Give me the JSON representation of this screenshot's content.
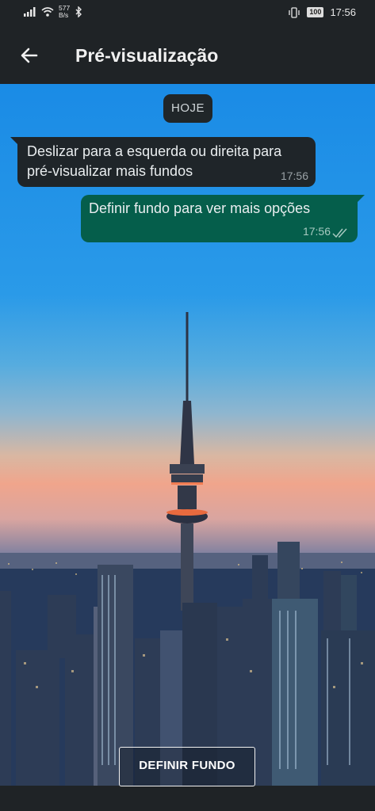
{
  "status_bar": {
    "net_speed_value": "577",
    "net_speed_unit": "B/s",
    "battery": "100",
    "time": "17:56"
  },
  "header": {
    "title": "Pré-visualização",
    "back_icon": "arrow-back-icon"
  },
  "preview": {
    "date_chip": "HOJE",
    "incoming": {
      "text": "Deslizar para a esquerda ou direita para pré-visualizar mais fundos",
      "time": "17:56"
    },
    "outgoing": {
      "text": "Definir fundo para ver mais opções",
      "time": "17:56",
      "status_icon": "double-check-icon"
    }
  },
  "action": {
    "set_wallpaper_label": "DEFINIR FUNDO"
  },
  "colors": {
    "bar_background": "#1f2326",
    "incoming_bubble": "#1f2529",
    "outgoing_bubble": "#055e4b"
  }
}
